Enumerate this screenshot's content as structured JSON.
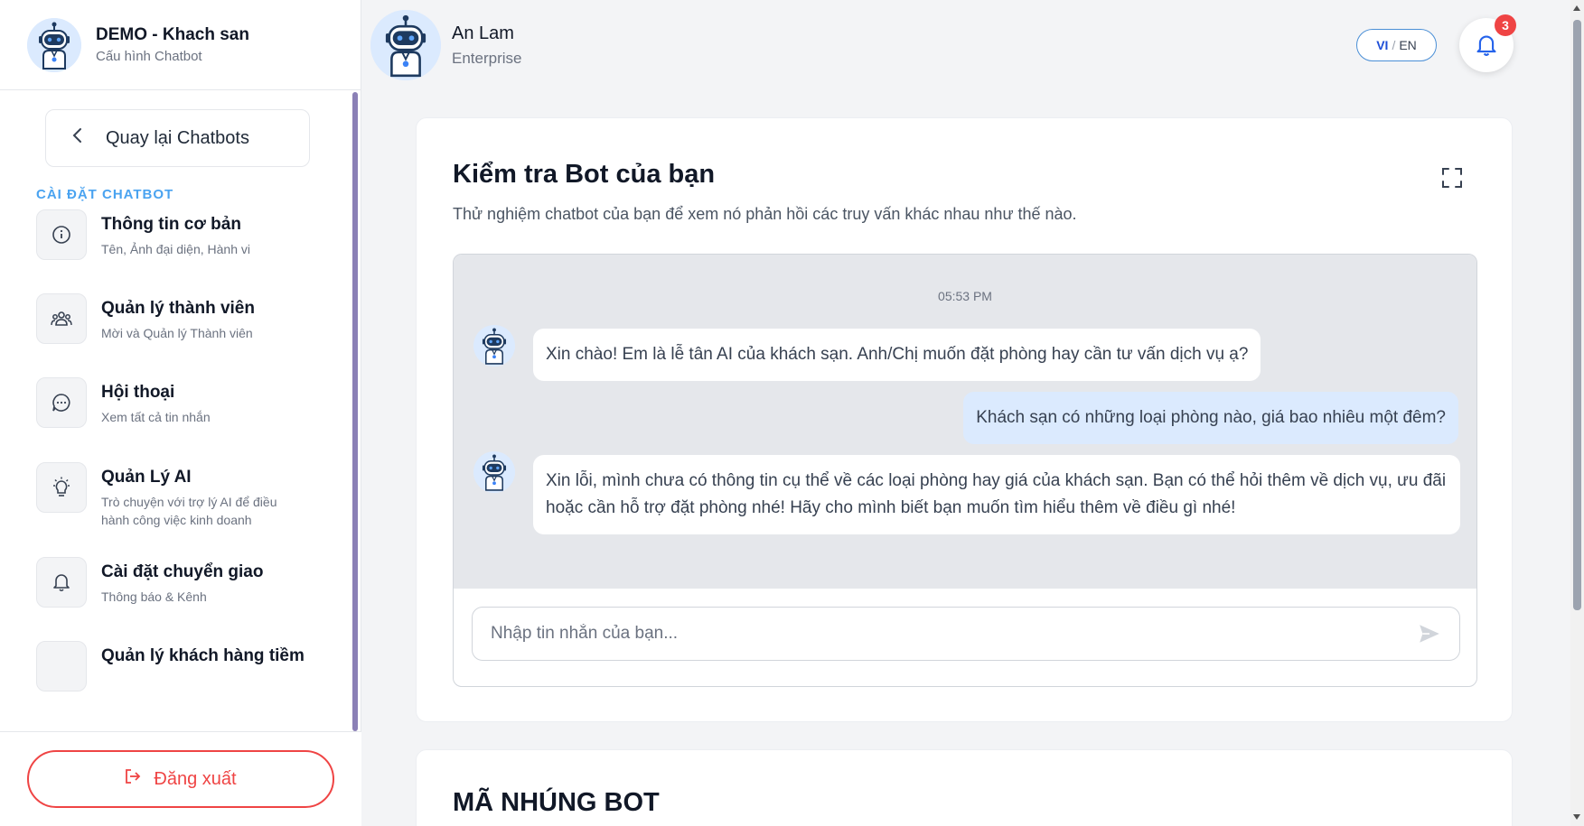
{
  "sidebar": {
    "title": "DEMO - Khach san",
    "subtitle": "Cấu hình Chatbot",
    "back_label": "Quay lại Chatbots",
    "section_label": "CÀI ĐẶT CHATBOT",
    "items": [
      {
        "title": "Thông tin cơ bản",
        "desc": "Tên, Ảnh đại diện, Hành vi",
        "icon": "info-icon"
      },
      {
        "title": "Quản lý thành viên",
        "desc": "Mời và Quản lý Thành viên",
        "icon": "users-icon"
      },
      {
        "title": "Hội thoại",
        "desc": "Xem tất cả tin nhắn",
        "icon": "chat-icon"
      },
      {
        "title": "Quản Lý AI",
        "desc": "Trò chuyện với trợ lý AI để điều hành công việc kinh doanh",
        "icon": "lightbulb-icon"
      },
      {
        "title": "Cài đặt chuyển giao",
        "desc": "Thông báo & Kênh",
        "icon": "bell-icon"
      },
      {
        "title": "Quản lý khách hàng tiềm",
        "desc": "",
        "icon": "target-icon"
      }
    ],
    "logout_label": "Đăng xuất"
  },
  "header": {
    "user_name": "An Lam",
    "user_plan": "Enterprise",
    "lang_vi": "VI",
    "lang_sep": "/",
    "lang_en": "EN",
    "notification_count": "3"
  },
  "test_card": {
    "title": "Kiểm tra Bot của bạn",
    "subtitle": "Thử nghiệm chatbot của bạn để xem nó phản hồi các truy vấn khác nhau như thế nào.",
    "timestamp": "05:53 PM",
    "messages": [
      {
        "role": "bot",
        "text": "Xin chào! Em là lễ tân AI của khách sạn. Anh/Chị muốn đặt phòng hay cần tư vấn dịch vụ ạ?"
      },
      {
        "role": "user",
        "text": "Khách sạn có những loại phòng nào, giá bao nhiêu một đêm?"
      },
      {
        "role": "bot",
        "text": "Xin lỗi, mình chưa có thông tin cụ thể về các loại phòng hay giá của khách sạn. Bạn có thể hỏi thêm về dịch vụ, ưu đãi hoặc cần hỗ trợ đặt phòng nhé! Hãy cho mình biết bạn muốn tìm hiểu thêm về điều gì nhé!"
      }
    ],
    "input_placeholder": "Nhập tin nhắn của bạn..."
  },
  "embed_card": {
    "title": "MÃ NHÚNG BOT"
  },
  "colors": {
    "accent": "#4aa3f0",
    "danger": "#ef4444",
    "user_bubble": "#dbeafe",
    "chat_bg": "#e5e7eb"
  }
}
